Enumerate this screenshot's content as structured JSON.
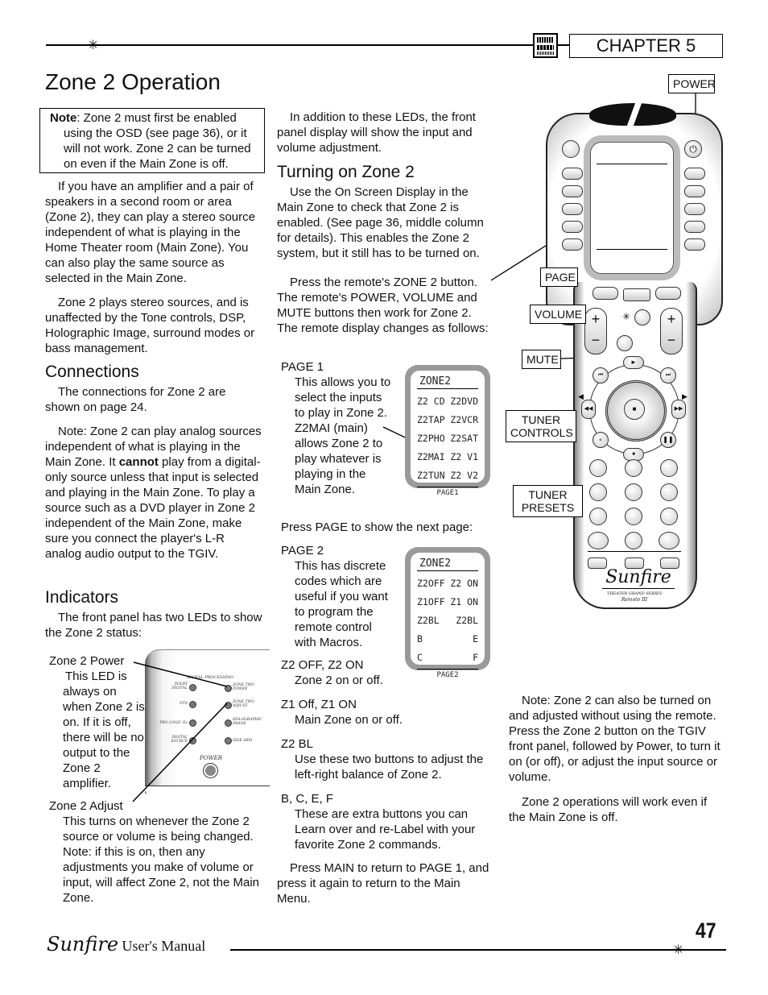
{
  "header": {
    "chapter_label": "CHAPTER 5",
    "logo_icon": "dts-dolby-logo-icon",
    "ornament_icon": "star-icon"
  },
  "page_title": "Zone 2 Operation",
  "left_column": {
    "note_label": "Note",
    "note_text": ": Zone 2 must first be enabled using the OSD (see page 36), or it will not work. Zone 2 can be turned on even if the Main Zone is off.",
    "intro_paragraphs": [
      "If you have an amplifier and a pair of speakers in a second room or area (Zone 2), they can play a stereo source independent of what is playing in the Home Theater room (Main Zone). You can also play the same source as selected in the Main Zone.",
      "Zone 2 plays stereo sources, and is unaffected by the Tone controls, DSP, Holographic Image, surround modes or bass management."
    ],
    "connections": {
      "heading": "Connections",
      "p1": "The connections for Zone 2 are shown on page 24.",
      "p2_before": "Note: Zone 2 can play analog sources independent of what is playing in the Main Zone. It ",
      "p2_bold": "cannot",
      "p2_after": " play from a digital-only source unless that input is selected and playing in the Main Zone. To play a source such as a DVD player in Zone 2 independent of the Main Zone, make sure you connect the player's L-R analog audio output to the TGIV."
    },
    "indicators": {
      "heading": "Indicators",
      "intro": "The front panel has two LEDs to show the Zone 2 status:",
      "zone2_power_title": "Zone 2 Power",
      "zone2_power_desc": "This LED is always on when Zone 2 is on. If it is off, there will be no output to the Zone 2 amplifier.",
      "zone2_adjust_title": "Zone 2 Adjust",
      "zone2_adjust_desc": "This turns on whenever the Zone 2 source or volume is being changed. Note: if this is on, then any adjustments you make of volume or input, will affect Zone 2, not the Main Zone."
    },
    "front_panel": {
      "section_label": "SIGNAL PROCESSING",
      "left_leds": [
        "DOLBY DIGITAL",
        "DTS",
        "PRO LOGIC IIx",
        "DIGITAL SOURCE"
      ],
      "right_leds": [
        "ZONE TWO POWER",
        "ZONE TWO ADJUST",
        "HOLOGRAPHIC IMAGE",
        "SIDE AXIS"
      ],
      "power_label": "POWER"
    }
  },
  "middle_column": {
    "intro": "In addition to these LEDs, the front panel display will show the input and volume adjustment.",
    "heading": "Turning on Zone 2",
    "p1": "Use the On Screen Display in the Main Zone to check that Zone 2 is enabled. (See page 36, middle column for details). This enables the Zone 2 system, but it still has to be turned on.",
    "p2": "Press the remote's ZONE 2 button. The remote's POWER, VOLUME and MUTE buttons then work for Zone 2. The remote display changes as follows:",
    "page1_title": "PAGE 1",
    "page1_desc": "This allows you to select the inputs to play in Zone 2. Z2MAI (main) allows Zone 2 to play whatever is playing in the Main Zone.",
    "press_page": "Press PAGE to show the next page:",
    "page2_title": "PAGE 2",
    "page2_desc": "This has discrete codes which are useful if you want to program the remote control with Macros.",
    "items": [
      {
        "title": "Z2 OFF, Z2 ON",
        "desc": "Zone 2 on or off."
      },
      {
        "title": "Z1 Off, Z1 ON",
        "desc": "Main Zone on or off."
      },
      {
        "title": "Z2 BL",
        "desc": "Use these two buttons to adjust the left-right balance of Zone 2."
      },
      {
        "title": "B, C, E, F",
        "desc": "These are extra buttons you can Learn over and re-Label with your favorite Zone 2 commands."
      }
    ],
    "closing": "Press MAIN to return to PAGE 1, and press it again to return to the Main Menu.",
    "lcd_page1": {
      "title": "ZONE2",
      "rows": [
        [
          "Z2 CD",
          "Z2DVD"
        ],
        [
          "Z2TAP",
          "Z2VCR"
        ],
        [
          "Z2PHO",
          "Z2SAT"
        ],
        [
          "Z2MAI",
          "Z2 V1"
        ],
        [
          "Z2TUN",
          "Z2 V2"
        ]
      ],
      "footer": "PAGE1"
    },
    "lcd_page2": {
      "title": "ZONE2",
      "rows": [
        [
          "Z2OFF",
          "Z2 ON"
        ],
        [
          "Z1OFF",
          "Z1 ON"
        ],
        [
          "Z2BL",
          "Z2BL"
        ],
        [
          "B",
          "E"
        ],
        [
          "C",
          "F"
        ]
      ],
      "footer": "PAGE2"
    }
  },
  "right_column": {
    "callouts": {
      "power": "POWER",
      "page": "PAGE",
      "volume": "VOLUME",
      "mute": "MUTE",
      "tuner_controls": "TUNER CONTROLS",
      "tuner_presets": "TUNER PRESETS"
    },
    "remote_brand": "Sunfire",
    "remote_series": "THEATER GRAND SERIES",
    "remote_model": "Remote III",
    "note": "Note: Zone 2 can also be turned on and adjusted without using the remote. Press the Zone 2 button on the TGIV front panel, followed by Power, to turn it on (or off), or adjust the input source or volume.",
    "p2": "Zone 2 operations will work even if the Main Zone is off."
  },
  "footer": {
    "brand": "Sunfire",
    "manual_label": "User's Manual",
    "page_number": "47"
  }
}
